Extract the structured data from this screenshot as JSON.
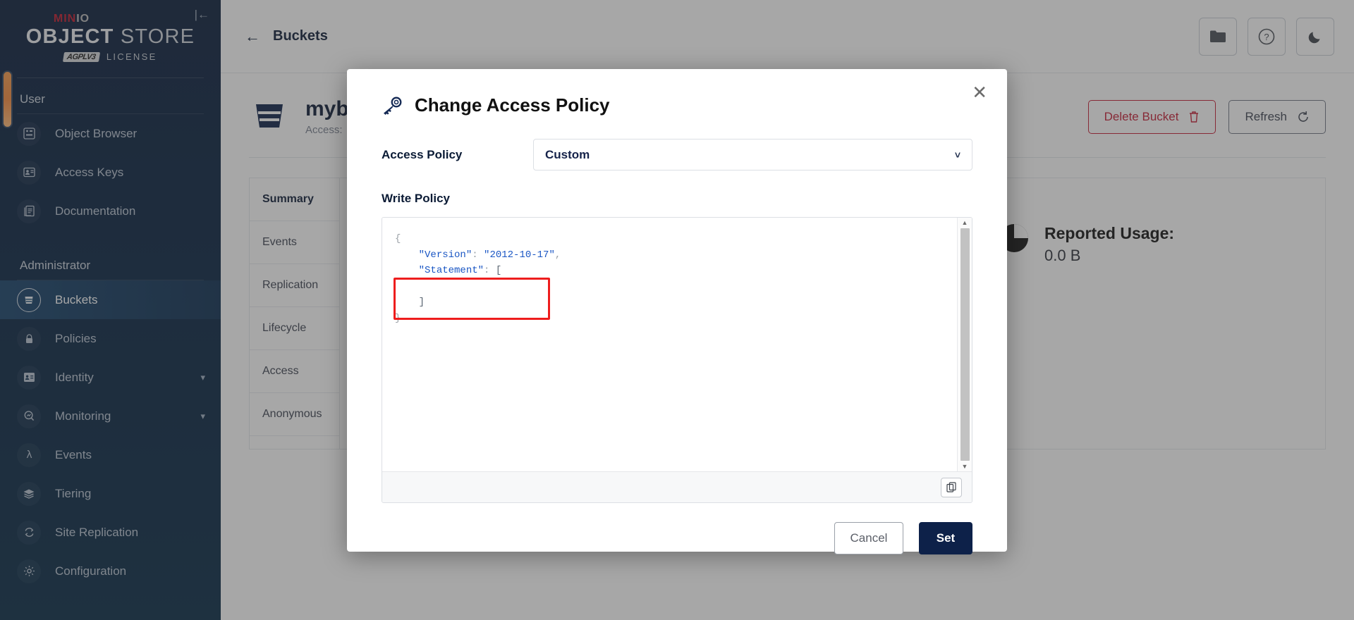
{
  "sidebar": {
    "logo": {
      "brand_min": "MIN",
      "brand_io": "IO",
      "object": "OBJECT",
      "store": " STORE",
      "agpl_badge": "AGPLV3",
      "license": "LICENSE"
    },
    "collapse_icon": "collapse-left-icon",
    "sections": [
      {
        "title": "User",
        "items": [
          {
            "label": "Object Browser",
            "icon": "object-browser-icon",
            "active": false,
            "expandable": false
          },
          {
            "label": "Access Keys",
            "icon": "access-keys-icon",
            "active": false,
            "expandable": false
          },
          {
            "label": "Documentation",
            "icon": "documentation-icon",
            "active": false,
            "expandable": false
          }
        ]
      },
      {
        "title": "Administrator",
        "items": [
          {
            "label": "Buckets",
            "icon": "bucket-icon",
            "active": true,
            "expandable": false
          },
          {
            "label": "Policies",
            "icon": "policies-lock-icon",
            "active": false,
            "expandable": false
          },
          {
            "label": "Identity",
            "icon": "identity-card-icon",
            "active": false,
            "expandable": true
          },
          {
            "label": "Monitoring",
            "icon": "monitoring-icon",
            "active": false,
            "expandable": true
          },
          {
            "label": "Events",
            "icon": "lambda-icon",
            "active": false,
            "expandable": false
          },
          {
            "label": "Tiering",
            "icon": "tiering-layers-icon",
            "active": false,
            "expandable": false
          },
          {
            "label": "Site Replication",
            "icon": "site-replication-icon",
            "active": false,
            "expandable": false
          },
          {
            "label": "Configuration",
            "icon": "gear-icon",
            "active": false,
            "expandable": false
          }
        ]
      }
    ]
  },
  "topbar": {
    "back_label": "Buckets",
    "buttons": [
      {
        "name": "folder-icon"
      },
      {
        "name": "help-icon"
      },
      {
        "name": "dark-mode-icon"
      }
    ]
  },
  "page": {
    "bucket_name": "mybucket",
    "bucket_sub": "Access:",
    "delete_label": "Delete Bucket",
    "refresh_label": "Refresh",
    "tabs": [
      {
        "label": "Summary",
        "active": true
      },
      {
        "label": "Events",
        "active": false
      },
      {
        "label": "Replication",
        "active": false
      },
      {
        "label": "Lifecycle",
        "active": false
      },
      {
        "label": "Access",
        "active": false
      },
      {
        "label": "Anonymous",
        "active": false
      }
    ],
    "usage_title": "Reported Usage:",
    "usage_value": "0.0 B"
  },
  "modal": {
    "title": "Change Access Policy",
    "title_icon": "key-policy-icon",
    "close_icon": "close-icon",
    "access_policy_label": "Access Policy",
    "access_policy_value": "Custom",
    "access_policy_options": [
      "Custom"
    ],
    "write_policy_label": "Write Policy",
    "policy_json": {
      "line_open": "{",
      "version_key": "\"Version\"",
      "version_sep": ": ",
      "version_value": "\"2012-10-17\"",
      "version_comma": ",",
      "statement_key": "\"Statement\"",
      "statement_sep": ": ",
      "statement_open": "[",
      "statement_close": "]",
      "line_close": "}"
    },
    "copy_icon": "copy-icon",
    "cancel_label": "Cancel",
    "set_label": "Set",
    "highlight_color": "#ee1d1d"
  },
  "colors": {
    "brand_red": "#c0172b",
    "navy": "#0d2149",
    "accent_orange": "#f6893b",
    "danger": "#c51c34"
  }
}
